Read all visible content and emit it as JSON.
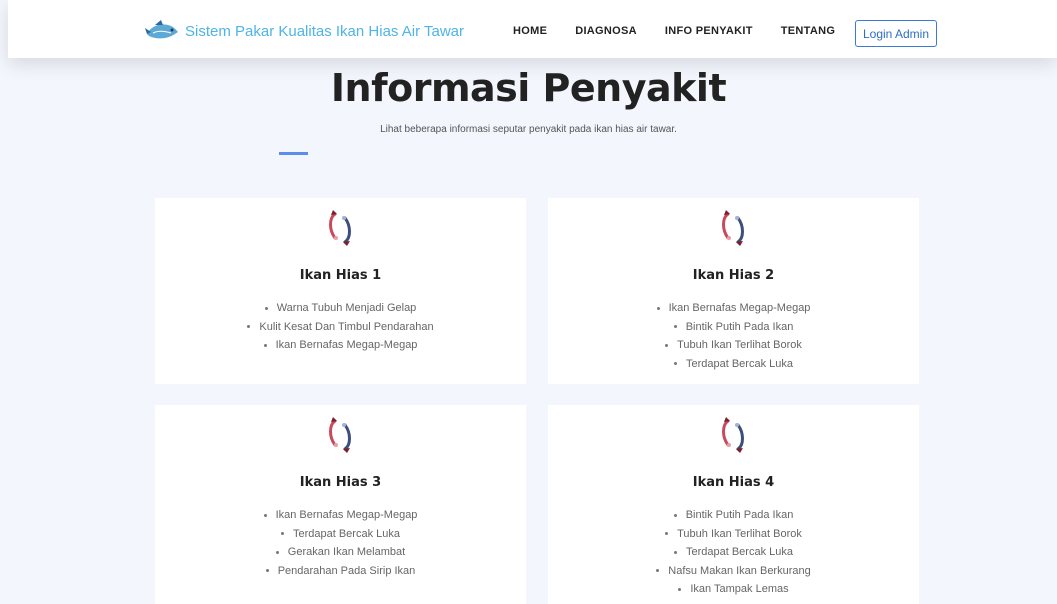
{
  "navbar": {
    "brand": "Sistem Pakar Kualitas Ikan Hias Air Tawar",
    "links": [
      "HOME",
      "DIAGNOSA",
      "INFO PENYAKIT",
      "TENTANG"
    ],
    "login_label": "Login Admin"
  },
  "header": {
    "title": "Informasi Penyakit",
    "subtitle": "Lihat beberapa informasi seputar penyakit pada ikan hias air tawar."
  },
  "cards": [
    {
      "title": "Ikan Hias 1",
      "symptoms": [
        "Warna Tubuh Menjadi Gelap",
        "Kulit Kesat Dan Timbul Pendarahan",
        "Ikan Bernafas Megap-Megap"
      ]
    },
    {
      "title": "Ikan Hias 2",
      "symptoms": [
        "Ikan Bernafas Megap-Megap",
        "Bintik Putih Pada Ikan",
        "Tubuh Ikan Terlihat Borok",
        "Terdapat Bercak Luka"
      ]
    },
    {
      "title": "Ikan Hias 3",
      "symptoms": [
        "Ikan Bernafas Megap-Megap",
        "Terdapat Bercak Luka",
        "Gerakan Ikan Melambat",
        "Pendarahan Pada Sirip Ikan"
      ]
    },
    {
      "title": "Ikan Hias 4",
      "symptoms": [
        "Bintik Putih Pada Ikan",
        "Tubuh Ikan Terlihat Borok",
        "Terdapat Bercak Luka",
        "Nafsu Makan Ikan Berkurang",
        "Ikan Tampak Lemas"
      ]
    }
  ],
  "colors": {
    "brand": "#4fb4e6",
    "accent": "#5b8def",
    "login_border": "#3a7bd5",
    "background": "#f4f6fe"
  },
  "icons": {
    "brand": "fish-logo-icon",
    "card": "koi-fish-icon"
  }
}
